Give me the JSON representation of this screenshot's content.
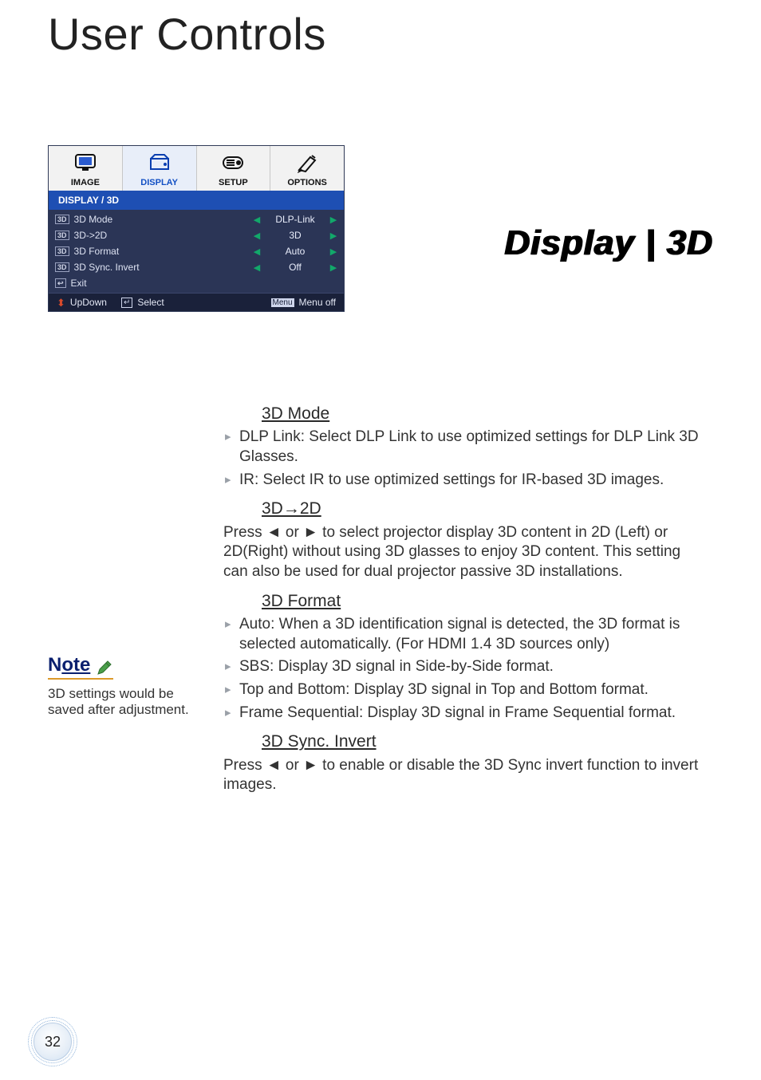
{
  "page_title": "User Controls",
  "section_heading": "Display | 3D",
  "page_number": "32",
  "osd": {
    "tabs": [
      {
        "label": "IMAGE"
      },
      {
        "label": "DISPLAY"
      },
      {
        "label": "SETUP"
      },
      {
        "label": "OPTIONS"
      }
    ],
    "selected_tab_index": 1,
    "breadcrumb": "DISPLAY / 3D",
    "rows": [
      {
        "icon": "3D",
        "label": "3D Mode",
        "value": "DLP-Link",
        "arrows": true
      },
      {
        "icon": "3D",
        "label": "3D->2D",
        "value": "3D",
        "arrows": true
      },
      {
        "icon": "3D",
        "label": "3D Format",
        "value": "Auto",
        "arrows": true
      },
      {
        "icon": "3D",
        "label": "3D Sync. Invert",
        "value": "Off",
        "arrows": true
      },
      {
        "icon": "↩",
        "label": "Exit",
        "value": "",
        "arrows": false
      }
    ],
    "footer": {
      "updown_label": "UpDown",
      "select_label": "Select",
      "menu_btn": "Menu",
      "menuoff_label": "Menu off"
    }
  },
  "note": {
    "label_prefix": "N",
    "label_rest": "ote",
    "text": "3D settings would be saved after adjustment."
  },
  "sections": {
    "mode": {
      "heading": "3D Mode",
      "bullets": [
        "DLP Link: Select DLP Link to use optimized settings for DLP Link 3D Glasses.",
        "IR: Select IR to use optimized settings for IR-based 3D images."
      ]
    },
    "to2d": {
      "heading": "3D→2D",
      "para": "Press ◄ or ► to select projector display 3D content in 2D (Left) or 2D(Right) without using 3D glasses to enjoy 3D content. This setting can also be used for dual projector passive 3D installations."
    },
    "format": {
      "heading": "3D Format",
      "bullets": [
        "Auto: When a 3D identification signal is detected, the 3D format is selected automatically. (For HDMI 1.4 3D sources only)",
        "SBS: Display 3D signal in Side-by-Side format.",
        "Top and Bottom: Display 3D signal in Top and Bottom format.",
        "Frame Sequential: Display 3D signal in Frame Sequential format."
      ]
    },
    "sync": {
      "heading": "3D Sync. Invert",
      "para": "Press ◄ or ► to enable or disable the 3D Sync invert function to invert images."
    }
  }
}
